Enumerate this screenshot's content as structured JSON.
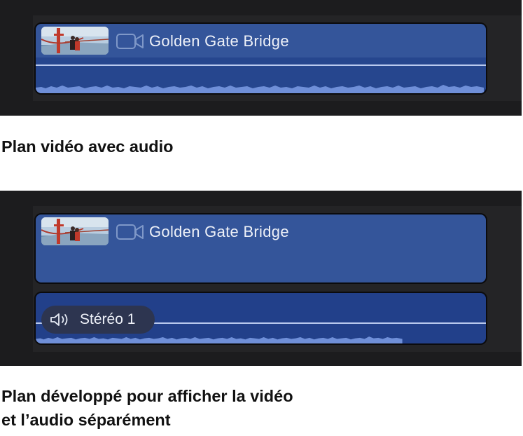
{
  "example_1": {
    "clip": {
      "title": "Golden Gate Bridge",
      "icon": "video-camera-icon",
      "thumbnail": "golden-gate-bridge-thumbnail"
    },
    "caption": "Plan vidéo avec audio"
  },
  "example_2": {
    "video_clip": {
      "title": "Golden Gate Bridge",
      "icon": "video-camera-icon",
      "thumbnail": "golden-gate-bridge-thumbnail"
    },
    "audio_clip": {
      "label": "Stéréo 1",
      "icon": "speaker-icon"
    },
    "caption_lines": [
      "Plan développé pour afficher la vidéo",
      "et l’audio séparément"
    ]
  },
  "colors": {
    "timeline_background": "#1c1c1e",
    "clip_blue": "#34559a",
    "audio_blue": "#22408a",
    "waveform": "#6f8fd8",
    "caption_text": "#111111"
  }
}
